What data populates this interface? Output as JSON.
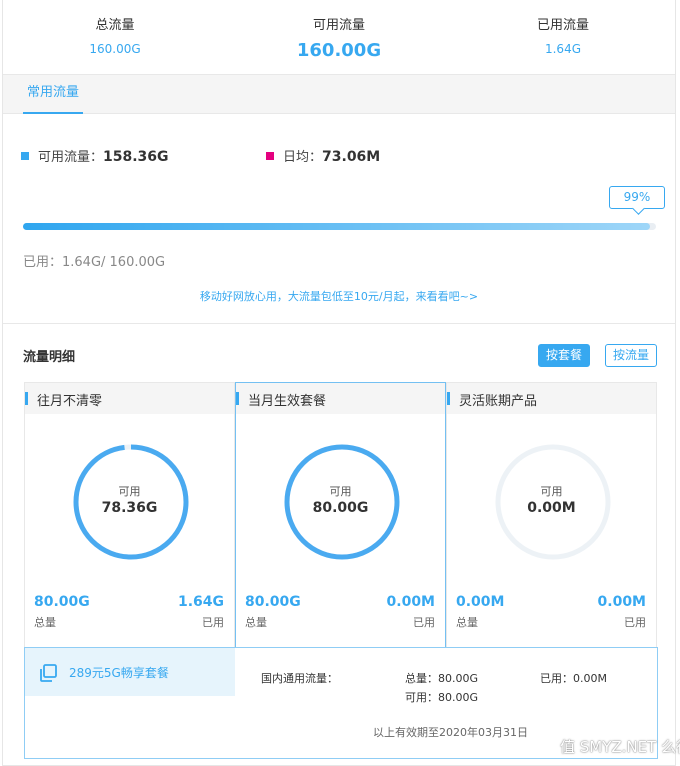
{
  "summary": {
    "total_label": "总流量",
    "total_value": "160.00G",
    "available_label": "可用流量",
    "available_value": "160.00G",
    "used_label": "已用流量",
    "used_value": "1.64G"
  },
  "tabs": [
    {
      "label": "常用流量"
    }
  ],
  "usage": {
    "available_prefix": "可用流量：",
    "available_value": "158.36G",
    "daily_prefix": "日均：",
    "daily_value": "73.06M",
    "percent_text": "99%",
    "percent": 99,
    "used_text": "已用：1.64G/ 160.00G",
    "promo_text": "移动好网放心用，大流量包低至10元/月起，来看看吧~>",
    "colors": {
      "available": "#37a8f0",
      "daily": "#e4007f"
    }
  },
  "detail": {
    "title": "流量明细",
    "by_package_label": "按套餐",
    "by_flow_label": "按流量",
    "cards": [
      {
        "title": "往月不清零",
        "ring_label": "可用",
        "ring_value": "78.36G",
        "ring_fraction": 0.98,
        "total_value": "80.00G",
        "total_label": "总量",
        "used_value": "1.64G",
        "used_label": "已用"
      },
      {
        "title": "当月生效套餐",
        "ring_label": "可用",
        "ring_value": "80.00G",
        "ring_fraction": 1.0,
        "total_value": "80.00G",
        "total_label": "总量",
        "used_value": "0.00M",
        "used_label": "已用"
      },
      {
        "title": "灵活账期产品",
        "ring_label": "可用",
        "ring_value": "0.00M",
        "ring_fraction": 0.0,
        "total_value": "0.00M",
        "total_label": "总量",
        "used_value": "0.00M",
        "used_label": "已用"
      }
    ],
    "plan": {
      "icon": "copy-icon",
      "name": "289元5G畅享套餐",
      "row_label": "国内通用流量：",
      "total_text": "总量：80.00G",
      "used_text": "已用：0.00M",
      "available_text": "可用：80.00G",
      "expire_text": "以上有效期至2020年03月31日"
    }
  },
  "watermark": "值 SMYZ.NET 么得买"
}
